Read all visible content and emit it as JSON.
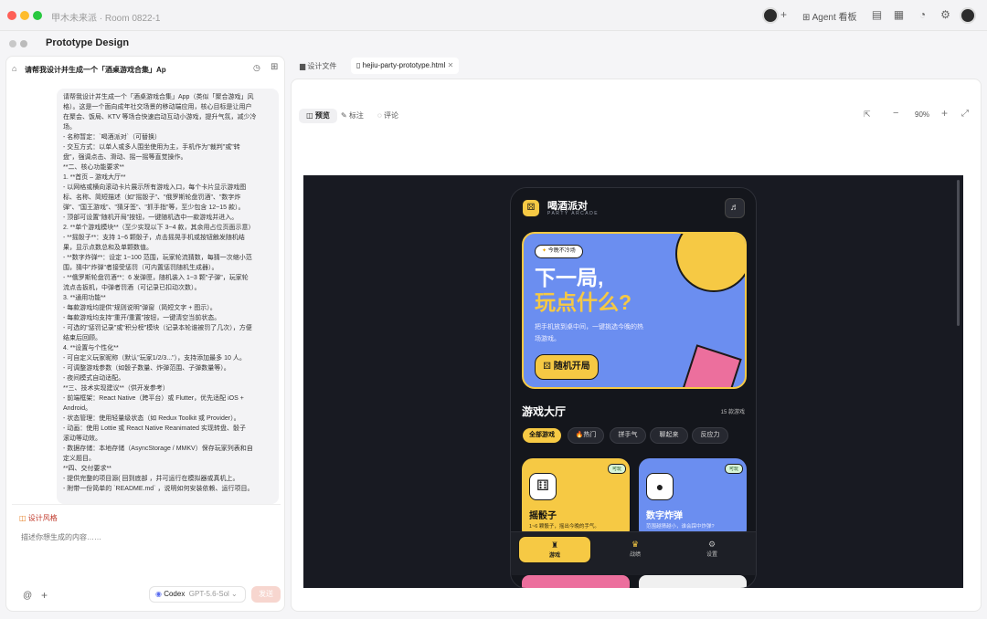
{
  "titlebar": {
    "title": "甲木未来派 · Room 0822-1",
    "agent_label": "Agent 看板"
  },
  "panel": {
    "title": "Prototype Design"
  },
  "left": {
    "header": "请帮我设计并生成一个「酒桌游戏合集」Ap",
    "prompt_lines": [
      "请帮我设计并生成一个「酒桌游戏合集」App（类似「聚合游戏」风",
      "格）。这是一个面向成年社交场景的移动端应用，核心目标是让用户",
      "在聚会、饭局、KTV 等场合快速启动互动小游戏，提升气氛，减少冷",
      "场。",
      "- 名称暂定：`喝酒派对`（可替换）",
      "- 交互方式：以单人或多人围坐使用为主，手机作为\"裁判\"或\"转",
      "盘\"，强调点击、滑动、摇一摇等直觉操作。",
      "**二、核心功能要求**",
      "1. **首页 – 游戏大厅**",
      "- 以网格或横向滚动卡片展示所有游戏入口，每个卡片显示游戏图",
      "标、名称、简短描述（如\"摇骰子\"、\"俄罗斯轮盘罚酒\"、\"数字炸",
      "弹\"、\"国王游戏\"、\"猜牙签\"、\"抓手指\"等，至少包含 12~15 款）。",
      "- 顶部可设置\"随机开局\"按钮，一键随机选中一款游戏并进入。",
      "2. **单个游戏模块**（至少实现以下 3~4 款，其余用占位页面示意）",
      "- **摇骰子**：支持 1~6 颗骰子，点击摇晃手机或按钮触发随机结",
      "果，显示点数总和及单颗数值。",
      "- **数字炸弹**：设定 1~100 范围，玩家轮流猜数，每猜一次缩小范",
      "围，猜中\"炸弹\"者接受惩罚（可内置惩罚随机生成器）。",
      "- **俄罗斯轮盘罚酒**：6 发弹匣，随机装入 1~3 颗\"子弹\"，玩家轮",
      "流点击扳机，中弹者罚酒（可记录已扣动次数）。",
      "3. **通用功能**",
      "- 每款游戏均提供\"规则说明\"弹窗（简短文字 + 图示）。",
      "- 每款游戏均支持\"重开/重置\"按钮，一键清空当前状态。",
      "- 可选的\"惩罚记录\"或\"积分榜\"模块（记录本轮谁被罚了几次），方便",
      "结束后回顾。",
      "4. **设置与个性化**",
      "- 可自定义玩家昵称（默认\"玩家1/2/3...\"），支持添加最多 10 人。",
      "- 可调整游戏参数（如骰子数量、炸弹范围、子弹数量等）。",
      "- 夜间模式自动适配。",
      "**三、技术实现建议**（供开发参考）",
      "- 前端框架：React Native（跨平台）或 Flutter，优先适配 iOS +",
      "Android。",
      "- 状态管理：使用轻量级状态（如 Redux Toolkit 或 Provider）。",
      "- 动画：使用 Lottie 或 React Native Reanimated 实现转盘、骰子",
      "滚动等动效。",
      "- 数据存储：本地存储（AsyncStorage / MMKV）保存玩家列表和自",
      "定义题目。",
      "**四、交付要求**",
      "- 提供完整的项目源(    回到底部    ，并可运行在模拟器或真机上。",
      "- 附带一份简单的 `README.md` ，说明如何安装依赖、运行项目。"
    ],
    "design_style_label": "设计风格",
    "input_placeholder": "描述你想生成的内容……",
    "model_name": "Codex",
    "model_version": "GPT-5.6-Sol",
    "send_label": "发送"
  },
  "right": {
    "tab_files": "设计文件",
    "tab_active": "hejiu-party-prototype.html",
    "tool_preview": "预览",
    "tool_annotate": "标注",
    "tool_comment": "评论",
    "zoom": "90%"
  },
  "app": {
    "name": "喝酒派对",
    "subtitle": "PARTY ARCADE",
    "badge": "今晚不冷场",
    "hero_line1": "下一局,",
    "hero_line2": "玩点什么?",
    "hero_desc_1": "把手机放到桌中间，一键挑选今晚的热",
    "hero_desc_2": "场游戏。",
    "random_button": "随机开局",
    "hall_title": "游戏大厅",
    "hall_count": "15 款游戏",
    "chips": [
      "全部游戏",
      "热门",
      "拼手气",
      "聊起来",
      "反应力"
    ],
    "cards": [
      {
        "tag": "可玩",
        "title": "摇骰子",
        "desc": "1~6 颗骰子，摇出今晚的手气。"
      },
      {
        "tag": "可玩",
        "title": "数字炸弹",
        "desc": "范围越猜越小，谁会踩中炸弹?"
      }
    ],
    "nav": [
      "游戏",
      "战绩",
      "设置"
    ]
  },
  "colors": {
    "accent_yellow": "#f6c944",
    "hero_blue": "#6b8ef0",
    "pink": "#ec6f9d",
    "app_bg": "#14161c"
  }
}
